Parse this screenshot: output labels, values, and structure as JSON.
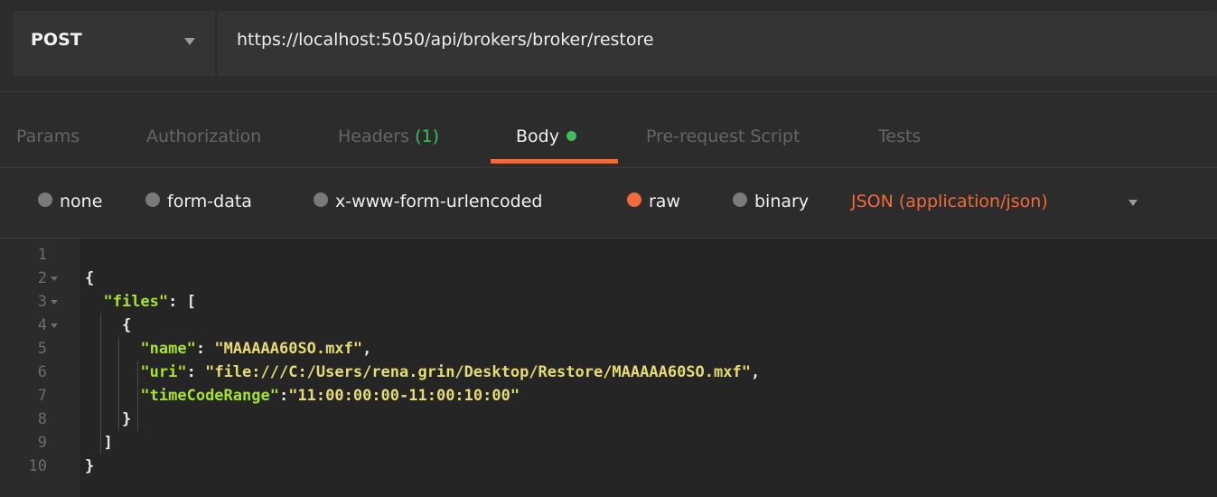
{
  "request": {
    "method": "POST",
    "url": "https://localhost:5050/api/brokers/broker/restore"
  },
  "tabs": [
    {
      "label": "Params"
    },
    {
      "label": "Authorization"
    },
    {
      "label": "Headers",
      "count": "(1)"
    },
    {
      "label": "Body",
      "active": true
    },
    {
      "label": "Pre-request Script"
    },
    {
      "label": "Tests"
    }
  ],
  "body_types": {
    "options": [
      "none",
      "form-data",
      "x-www-form-urlencoded",
      "raw",
      "binary"
    ],
    "selected": "raw",
    "content_type": "JSON (application/json)"
  },
  "editor": {
    "line_numbers": [
      "1",
      "2",
      "3",
      "4",
      "5",
      "6",
      "7",
      "8",
      "9",
      "10"
    ],
    "lines": [
      {
        "indent": "",
        "parts": []
      },
      {
        "indent": "",
        "parts": [
          {
            "t": "p",
            "v": "{"
          }
        ]
      },
      {
        "indent": "  ",
        "parts": [
          {
            "t": "k",
            "v": "\"files\""
          },
          {
            "t": "p",
            "v": ": ["
          }
        ]
      },
      {
        "indent": "    ",
        "parts": [
          {
            "t": "p",
            "v": "{"
          }
        ]
      },
      {
        "indent": "      ",
        "parts": [
          {
            "t": "k",
            "v": "\"name\""
          },
          {
            "t": "p",
            "v": ": "
          },
          {
            "t": "s",
            "v": "\"MAAAAA60SO.mxf\""
          },
          {
            "t": "p",
            "v": ","
          }
        ]
      },
      {
        "indent": "      ",
        "parts": [
          {
            "t": "k",
            "v": "\"uri\""
          },
          {
            "t": "p",
            "v": ": "
          },
          {
            "t": "s",
            "v": "\"file:///C:/Users/rena.grin/Desktop/Restore/MAAAAA60SO.mxf\""
          },
          {
            "t": "p",
            "v": ","
          }
        ]
      },
      {
        "indent": "      ",
        "parts": [
          {
            "t": "k",
            "v": "\"timeCodeRange\""
          },
          {
            "t": "p",
            "v": ":"
          },
          {
            "t": "s",
            "v": "\"11:00:00:00-11:00:10:00\""
          }
        ]
      },
      {
        "indent": "    ",
        "parts": [
          {
            "t": "p",
            "v": "}"
          }
        ]
      },
      {
        "indent": "  ",
        "parts": [
          {
            "t": "p",
            "v": "]"
          }
        ]
      },
      {
        "indent": "",
        "parts": [
          {
            "t": "p",
            "v": "}"
          }
        ]
      }
    ],
    "foldable_lines": [
      2,
      3,
      4
    ]
  },
  "colors": {
    "accent": "#f06b3c",
    "body_dot": "#3fbf5c",
    "json_key": "#a6e22e",
    "json_string": "#e6db74"
  }
}
